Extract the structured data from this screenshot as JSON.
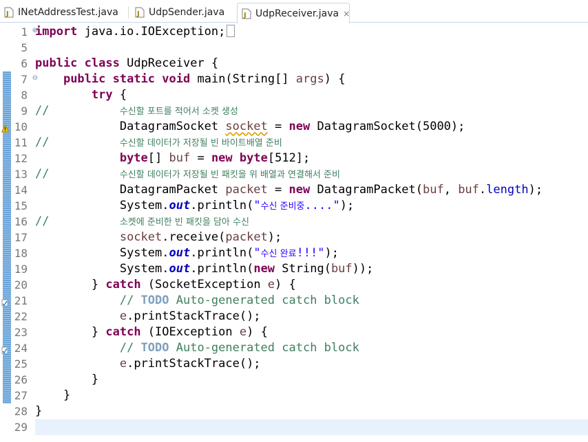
{
  "tabs": [
    {
      "label": "INetAddressTest.java",
      "icon": "java-file-icon",
      "active": false
    },
    {
      "label": "UdpSender.java",
      "icon": "java-file-icon",
      "active": false
    },
    {
      "label": "UdpReceiver.java",
      "icon": "java-file-icon",
      "active": true,
      "close": "×"
    }
  ],
  "editor": {
    "line_numbers": [
      "1",
      "5",
      "6",
      "7",
      "8",
      "9",
      "10",
      "11",
      "12",
      "13",
      "14",
      "15",
      "16",
      "17",
      "18",
      "19",
      "20",
      "21",
      "22",
      "23",
      "24",
      "25",
      "26",
      "27",
      "28",
      "29"
    ],
    "tokens": {
      "import": "import",
      "import_rest": " java.io.IOException;",
      "public": "public",
      "class": "class",
      "class_rest": " UdpReceiver {",
      "static": "static",
      "void": "void",
      "main_rest": " main(String[] ",
      "args": "args",
      "main_end": ") {",
      "try": "try",
      "try_rest": " {",
      "slashes": "//",
      "c9": "수신할 포트를 적어서 소켓 생성",
      "ds_type": "DatagramSocket ",
      "socket": "socket",
      "eq": " = ",
      "new": "new",
      "ds_ctor": " DatagramSocket(5000);",
      "c11": "수신할 데이터가 저장될 빈 바이트배열 준비",
      "byte": "byte",
      "buf_decl": "[] ",
      "buf": "buf",
      "byte_arr": "[512];",
      "c13": "수신할 데이터가 저장될 빈 패킷을 위 배열과 연결해서 준비",
      "dp_type": "DatagramPacket ",
      "packet": "packet",
      "dp_ctor": " DatagramPacket(",
      "comma": ", ",
      "dot": ".",
      "length": "length",
      "close_semi": ");",
      "system": "System.",
      "out": "out",
      "println_open": ".println(",
      "q": "\"",
      "s15": "수신 준비중",
      "s15_tail": "....\"",
      "c16": "소켓에 준비한 빈 패킷을 담아 수신",
      "receive_open": ".receive(",
      "s18": "수신 완료",
      "s18_tail": "!!!\"",
      "string_ctor": " String(",
      "double_close": "));",
      "catch_open": "} ",
      "catch": "catch",
      "catch1_rest": " (SocketException ",
      "e": "e",
      "catch_end": ") {",
      "todo_prefix": "// ",
      "todo": "TODO",
      "todo_rest": " Auto-generated catch block",
      "print_trace": ".printStackTrace();",
      "catch2_rest": " (IOException ",
      "rbrace": "}"
    }
  }
}
